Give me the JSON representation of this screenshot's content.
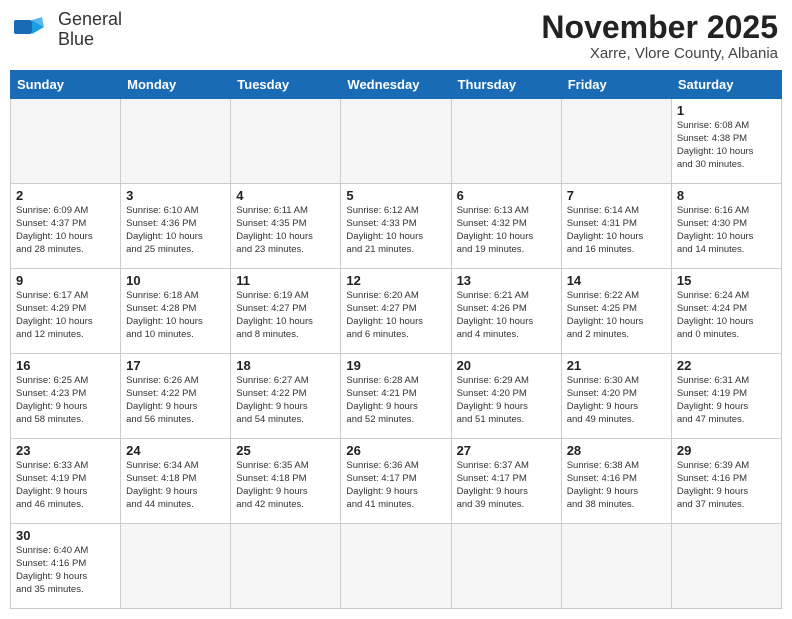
{
  "header": {
    "logo_line1": "General",
    "logo_line2": "Blue",
    "month": "November 2025",
    "location": "Xarre, Vlore County, Albania"
  },
  "weekdays": [
    "Sunday",
    "Monday",
    "Tuesday",
    "Wednesday",
    "Thursday",
    "Friday",
    "Saturday"
  ],
  "weeks": [
    [
      {
        "day": "",
        "info": ""
      },
      {
        "day": "",
        "info": ""
      },
      {
        "day": "",
        "info": ""
      },
      {
        "day": "",
        "info": ""
      },
      {
        "day": "",
        "info": ""
      },
      {
        "day": "",
        "info": ""
      },
      {
        "day": "1",
        "info": "Sunrise: 6:08 AM\nSunset: 4:38 PM\nDaylight: 10 hours\nand 30 minutes."
      }
    ],
    [
      {
        "day": "2",
        "info": "Sunrise: 6:09 AM\nSunset: 4:37 PM\nDaylight: 10 hours\nand 28 minutes."
      },
      {
        "day": "3",
        "info": "Sunrise: 6:10 AM\nSunset: 4:36 PM\nDaylight: 10 hours\nand 25 minutes."
      },
      {
        "day": "4",
        "info": "Sunrise: 6:11 AM\nSunset: 4:35 PM\nDaylight: 10 hours\nand 23 minutes."
      },
      {
        "day": "5",
        "info": "Sunrise: 6:12 AM\nSunset: 4:33 PM\nDaylight: 10 hours\nand 21 minutes."
      },
      {
        "day": "6",
        "info": "Sunrise: 6:13 AM\nSunset: 4:32 PM\nDaylight: 10 hours\nand 19 minutes."
      },
      {
        "day": "7",
        "info": "Sunrise: 6:14 AM\nSunset: 4:31 PM\nDaylight: 10 hours\nand 16 minutes."
      },
      {
        "day": "8",
        "info": "Sunrise: 6:16 AM\nSunset: 4:30 PM\nDaylight: 10 hours\nand 14 minutes."
      }
    ],
    [
      {
        "day": "9",
        "info": "Sunrise: 6:17 AM\nSunset: 4:29 PM\nDaylight: 10 hours\nand 12 minutes."
      },
      {
        "day": "10",
        "info": "Sunrise: 6:18 AM\nSunset: 4:28 PM\nDaylight: 10 hours\nand 10 minutes."
      },
      {
        "day": "11",
        "info": "Sunrise: 6:19 AM\nSunset: 4:27 PM\nDaylight: 10 hours\nand 8 minutes."
      },
      {
        "day": "12",
        "info": "Sunrise: 6:20 AM\nSunset: 4:27 PM\nDaylight: 10 hours\nand 6 minutes."
      },
      {
        "day": "13",
        "info": "Sunrise: 6:21 AM\nSunset: 4:26 PM\nDaylight: 10 hours\nand 4 minutes."
      },
      {
        "day": "14",
        "info": "Sunrise: 6:22 AM\nSunset: 4:25 PM\nDaylight: 10 hours\nand 2 minutes."
      },
      {
        "day": "15",
        "info": "Sunrise: 6:24 AM\nSunset: 4:24 PM\nDaylight: 10 hours\nand 0 minutes."
      }
    ],
    [
      {
        "day": "16",
        "info": "Sunrise: 6:25 AM\nSunset: 4:23 PM\nDaylight: 9 hours\nand 58 minutes."
      },
      {
        "day": "17",
        "info": "Sunrise: 6:26 AM\nSunset: 4:22 PM\nDaylight: 9 hours\nand 56 minutes."
      },
      {
        "day": "18",
        "info": "Sunrise: 6:27 AM\nSunset: 4:22 PM\nDaylight: 9 hours\nand 54 minutes."
      },
      {
        "day": "19",
        "info": "Sunrise: 6:28 AM\nSunset: 4:21 PM\nDaylight: 9 hours\nand 52 minutes."
      },
      {
        "day": "20",
        "info": "Sunrise: 6:29 AM\nSunset: 4:20 PM\nDaylight: 9 hours\nand 51 minutes."
      },
      {
        "day": "21",
        "info": "Sunrise: 6:30 AM\nSunset: 4:20 PM\nDaylight: 9 hours\nand 49 minutes."
      },
      {
        "day": "22",
        "info": "Sunrise: 6:31 AM\nSunset: 4:19 PM\nDaylight: 9 hours\nand 47 minutes."
      }
    ],
    [
      {
        "day": "23",
        "info": "Sunrise: 6:33 AM\nSunset: 4:19 PM\nDaylight: 9 hours\nand 46 minutes."
      },
      {
        "day": "24",
        "info": "Sunrise: 6:34 AM\nSunset: 4:18 PM\nDaylight: 9 hours\nand 44 minutes."
      },
      {
        "day": "25",
        "info": "Sunrise: 6:35 AM\nSunset: 4:18 PM\nDaylight: 9 hours\nand 42 minutes."
      },
      {
        "day": "26",
        "info": "Sunrise: 6:36 AM\nSunset: 4:17 PM\nDaylight: 9 hours\nand 41 minutes."
      },
      {
        "day": "27",
        "info": "Sunrise: 6:37 AM\nSunset: 4:17 PM\nDaylight: 9 hours\nand 39 minutes."
      },
      {
        "day": "28",
        "info": "Sunrise: 6:38 AM\nSunset: 4:16 PM\nDaylight: 9 hours\nand 38 minutes."
      },
      {
        "day": "29",
        "info": "Sunrise: 6:39 AM\nSunset: 4:16 PM\nDaylight: 9 hours\nand 37 minutes."
      }
    ],
    [
      {
        "day": "30",
        "info": "Sunrise: 6:40 AM\nSunset: 4:16 PM\nDaylight: 9 hours\nand 35 minutes."
      },
      {
        "day": "",
        "info": ""
      },
      {
        "day": "",
        "info": ""
      },
      {
        "day": "",
        "info": ""
      },
      {
        "day": "",
        "info": ""
      },
      {
        "day": "",
        "info": ""
      },
      {
        "day": "",
        "info": ""
      }
    ]
  ]
}
